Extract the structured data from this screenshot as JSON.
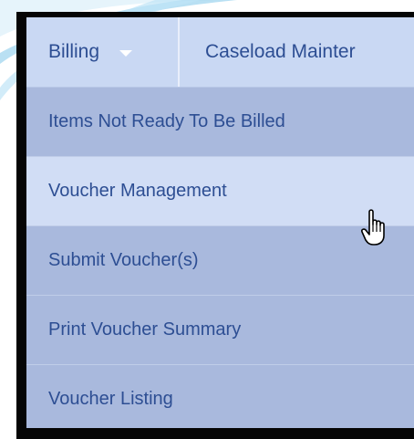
{
  "menubar": {
    "billing_label": "Billing",
    "caseload_label": "Caseload Mainter"
  },
  "billing_menu": {
    "items": [
      {
        "label": "Items Not Ready To Be Billed"
      },
      {
        "label": "Voucher Management"
      },
      {
        "label": "Submit Voucher(s)"
      },
      {
        "label": "Print Voucher Summary"
      },
      {
        "label": "Voucher Listing"
      }
    ],
    "hovered_item": "Voucher Management"
  },
  "icons": {
    "dropdown": "chevron-down-icon",
    "pointer": "hand-pointer-icon"
  },
  "colors": {
    "menubar_bg": "#c9d8f3",
    "menu_item_bg": "#a9b9dd",
    "menu_item_hover_bg": "#d1ddf5",
    "text": "#2d4e93",
    "frame": "#050505"
  }
}
